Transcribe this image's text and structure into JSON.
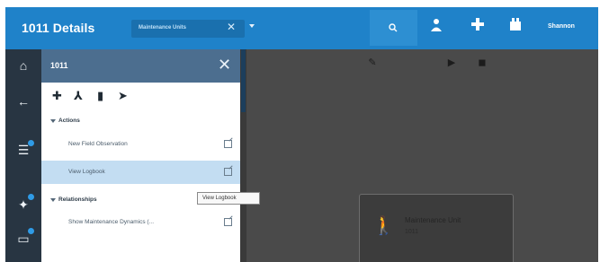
{
  "app": {
    "title": "1011 Details",
    "filter_chip": {
      "label": "Maintenance Units",
      "close_glyph": "✕",
      "caret": "dropdown-caret"
    },
    "search_icon": "search-icon",
    "user_name": "Shannon",
    "topbar_icons": [
      "person-icon",
      "plus-icon",
      "gift-icon"
    ]
  },
  "colors": {
    "topbar": "#1f82c9",
    "rail": "#283542",
    "panel_header": "#4c6e8f",
    "selected_row": "#c3ddf2",
    "main_dark": "#4a4a4a"
  },
  "rail": {
    "items": [
      {
        "icon": "home-icon",
        "glyph": "⌂"
      },
      {
        "icon": "back-arrow-icon",
        "glyph": "←"
      },
      {
        "icon": "list-icon",
        "glyph": "☰",
        "badge": true
      },
      {
        "icon": "pin-icon",
        "glyph": "✦",
        "badge": true
      },
      {
        "icon": "inbox-icon",
        "glyph": "▭",
        "badge": true
      }
    ]
  },
  "panel": {
    "title": "1011",
    "close_glyph": "✕",
    "tools": [
      {
        "icon": "pin-icon",
        "glyph": "✚"
      },
      {
        "icon": "hierarchy-icon",
        "glyph": "⅄"
      },
      {
        "icon": "document-icon",
        "glyph": "▮"
      },
      {
        "icon": "send-icon",
        "glyph": "➤"
      }
    ],
    "sections": [
      {
        "label": "Actions",
        "items": [
          {
            "label": "New Field Observation",
            "selected": false
          },
          {
            "label": "View Logbook",
            "selected": true
          }
        ]
      },
      {
        "label": "Relationships",
        "items": [
          {
            "label": "Show Maintenance Dynamics (...",
            "selected": false
          }
        ]
      }
    ],
    "tooltip": "View Logbook"
  },
  "main": {
    "toolbar_icons": [
      "edit-icon",
      "play-icon",
      "stop-icon"
    ],
    "asset": {
      "icon": "asset-person-icon",
      "name": "Maintenance Unit",
      "sub": "1011"
    }
  }
}
